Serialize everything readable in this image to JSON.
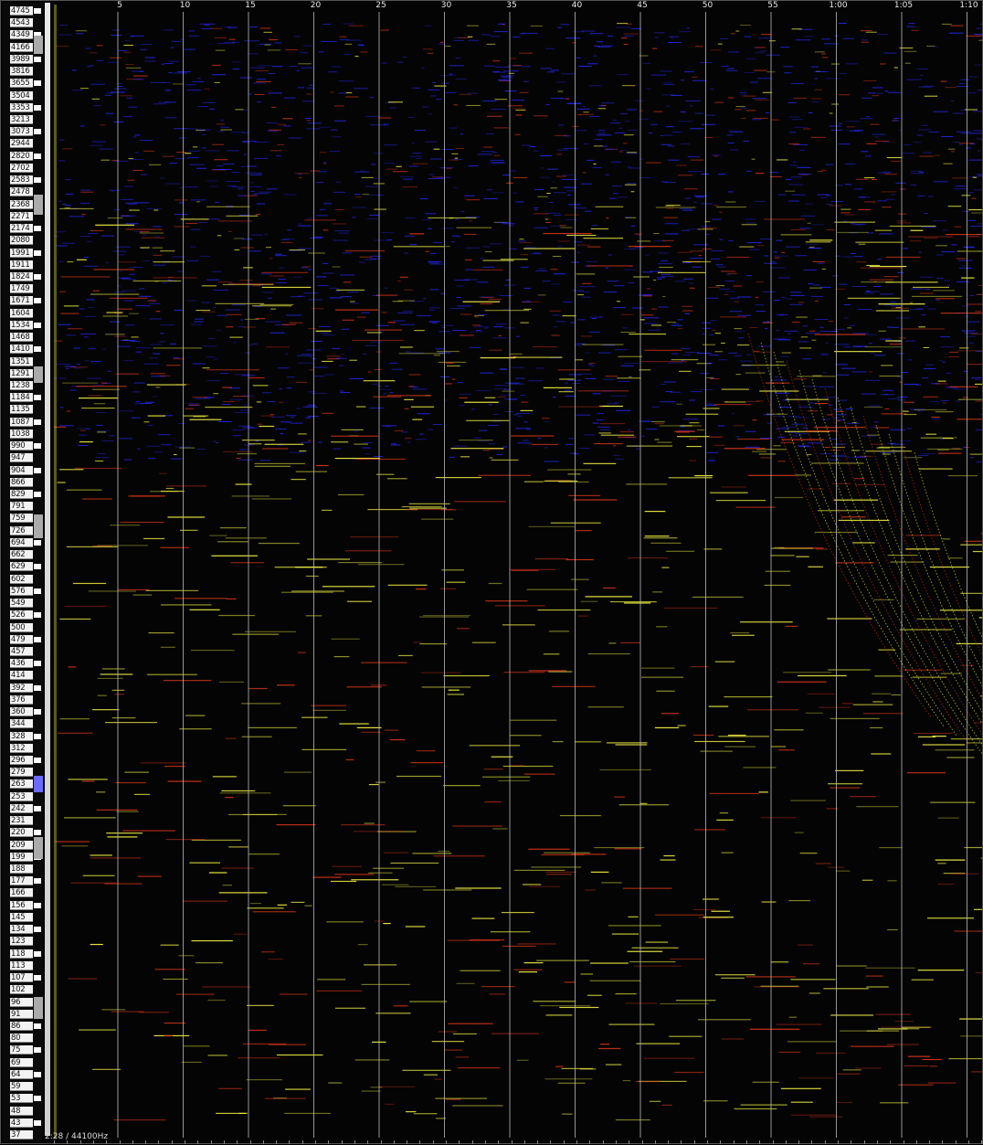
{
  "frequency_scale": {
    "labels": [
      "4745",
      "4543",
      "4349",
      "4166",
      "3989",
      "3816",
      "3655",
      "3504",
      "3353",
      "3213",
      "3073",
      "2944",
      "2820",
      "2702",
      "2583",
      "2478",
      "2368",
      "2271",
      "2174",
      "2080",
      "1991",
      "1911",
      "1824",
      "1749",
      "1671",
      "1604",
      "1534",
      "1468",
      "1410",
      "1351",
      "1291",
      "1238",
      "1184",
      "1135",
      "1087",
      "1038",
      "990",
      "947",
      "904",
      "866",
      "829",
      "791",
      "759",
      "726",
      "694",
      "662",
      "629",
      "602",
      "576",
      "549",
      "526",
      "500",
      "479",
      "457",
      "436",
      "414",
      "392",
      "376",
      "360",
      "344",
      "328",
      "312",
      "296",
      "279",
      "263",
      "253",
      "242",
      "231",
      "220",
      "209",
      "199",
      "188",
      "177",
      "166",
      "156",
      "145",
      "134",
      "123",
      "118",
      "113",
      "107",
      "102",
      "96",
      "91",
      "86",
      "80",
      "75",
      "69",
      "64",
      "59",
      "53",
      "48",
      "43",
      "37"
    ],
    "highlighted_key": "263",
    "highlight_color": "#6a6aff"
  },
  "time_ruler": {
    "labels": [
      "5",
      "10",
      "15",
      "20",
      "25",
      "30",
      "35",
      "40",
      "45",
      "50",
      "55",
      "1:00",
      "1:05",
      "1:10"
    ]
  },
  "status": {
    "text": "2:28 / 44100Hz"
  },
  "colors": {
    "background": "#000000",
    "gridline": "#bdbdbd",
    "low_energy": "#2a2aff",
    "mid_energy": "#e0381c",
    "high_energy": "#ffff4a"
  }
}
